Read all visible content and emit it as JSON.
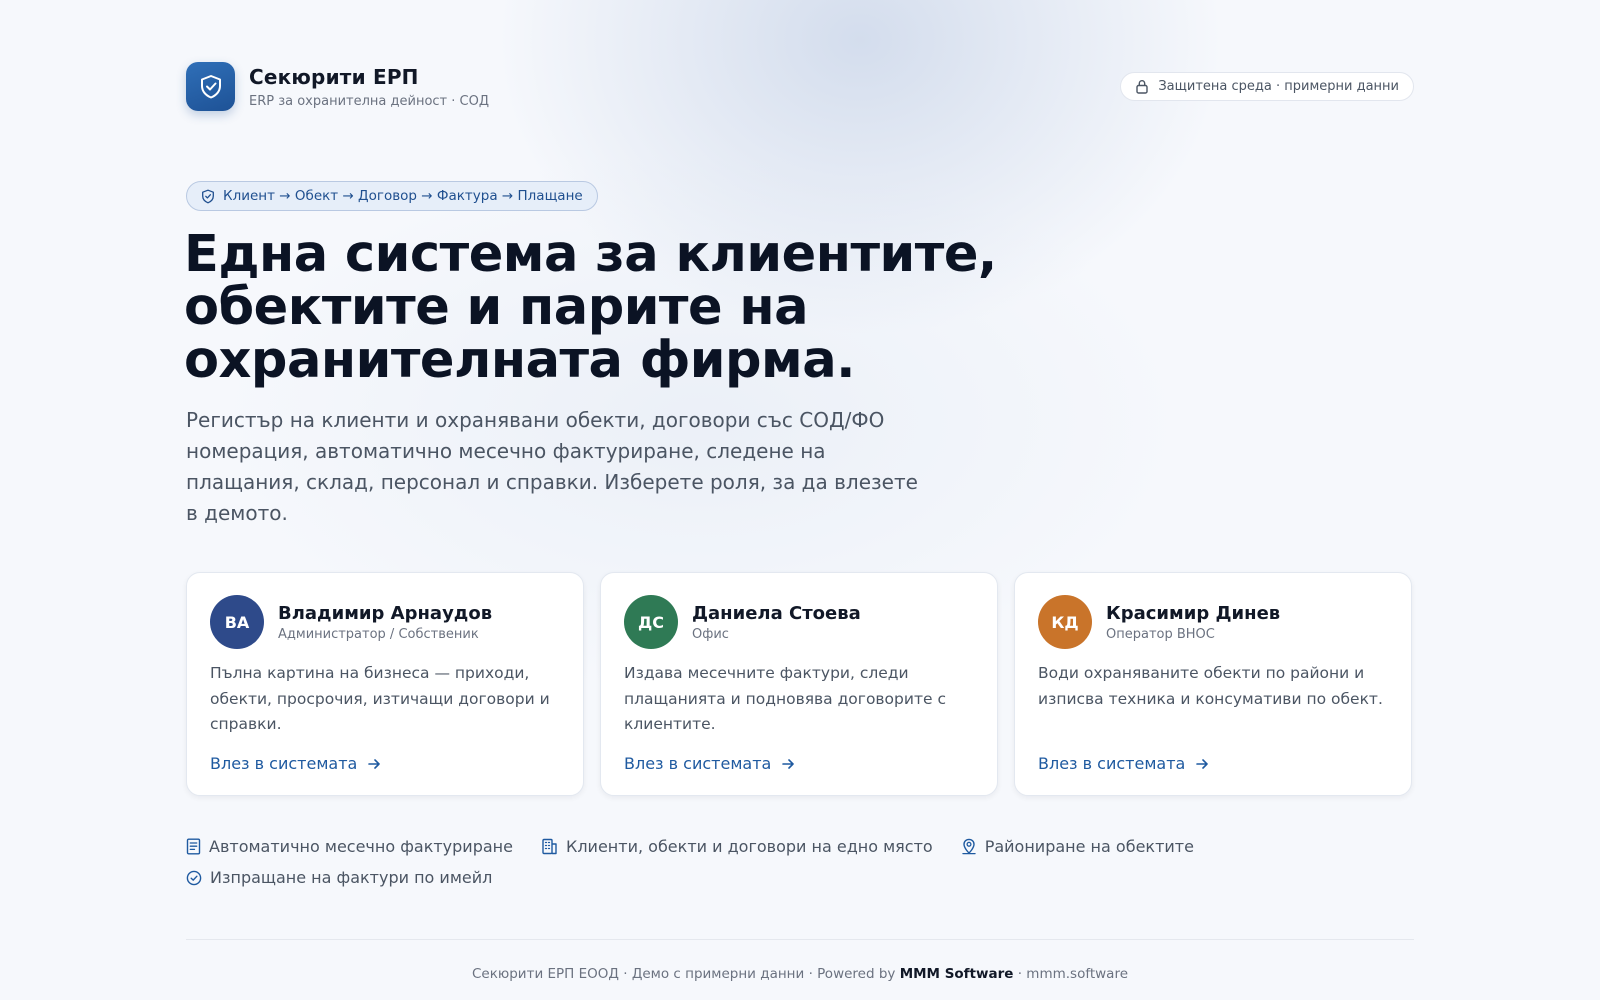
{
  "brand": {
    "name": "Секюрити ЕРП",
    "subtitle": "ERP за охранителна дейност · СОД"
  },
  "secure_badge": "Защитена среда · примерни данни",
  "flow_badge": "Клиент → Обект → Договор → Фактура → Плащане",
  "headline": "Една система за клиентите, обектите и парите на охранителната фирма.",
  "lead": "Регистър на клиенти и охранявани обекти, договори със СОД/ФО номерация, автоматично месечно фактуриране, следене на плащания, склад, персонал и справки. Изберете роля, за да влезете в демото.",
  "roles": [
    {
      "initials": "ВА",
      "color": "#2e4a8a",
      "name": "Владимир Арнаудов",
      "role": "Администратор / Собственик",
      "description": "Пълна картина на бизнеса — приходи, обекти, просрочия, изтичащи договори и справки.",
      "link": "Влез в системата"
    },
    {
      "initials": "ДС",
      "color": "#2f7a55",
      "name": "Даниела Стоева",
      "role": "Офис",
      "description": "Издава месечните фактури, следи плащанията и подновява договорите с клиентите.",
      "link": "Влез в системата"
    },
    {
      "initials": "КД",
      "color": "#c9742a",
      "name": "Красимир Динев",
      "role": "Оператор ВНОС",
      "description": "Води охраняваните обекти по райони и изписва техника и консумативи по обект.",
      "link": "Влез в системата"
    }
  ],
  "features": [
    {
      "icon": "document-icon",
      "label": "Автоматично месечно фактуриране"
    },
    {
      "icon": "building-icon",
      "label": "Клиенти, обекти и договори на едно място"
    },
    {
      "icon": "location-pin-icon",
      "label": "Райониране на обектите"
    },
    {
      "icon": "check-circle-icon",
      "label": "Изпращане на фактури по имейл"
    }
  ],
  "footer": {
    "prefix": "Секюрити ЕРП ЕООД · Демо с примерни данни · Powered by ",
    "brand": "MMM Software",
    "suffix": " · mmm.software"
  },
  "colors": {
    "accent": "#1f5aa0",
    "logo": "#2f6fb8",
    "flow_bg": "#e6eef9"
  }
}
